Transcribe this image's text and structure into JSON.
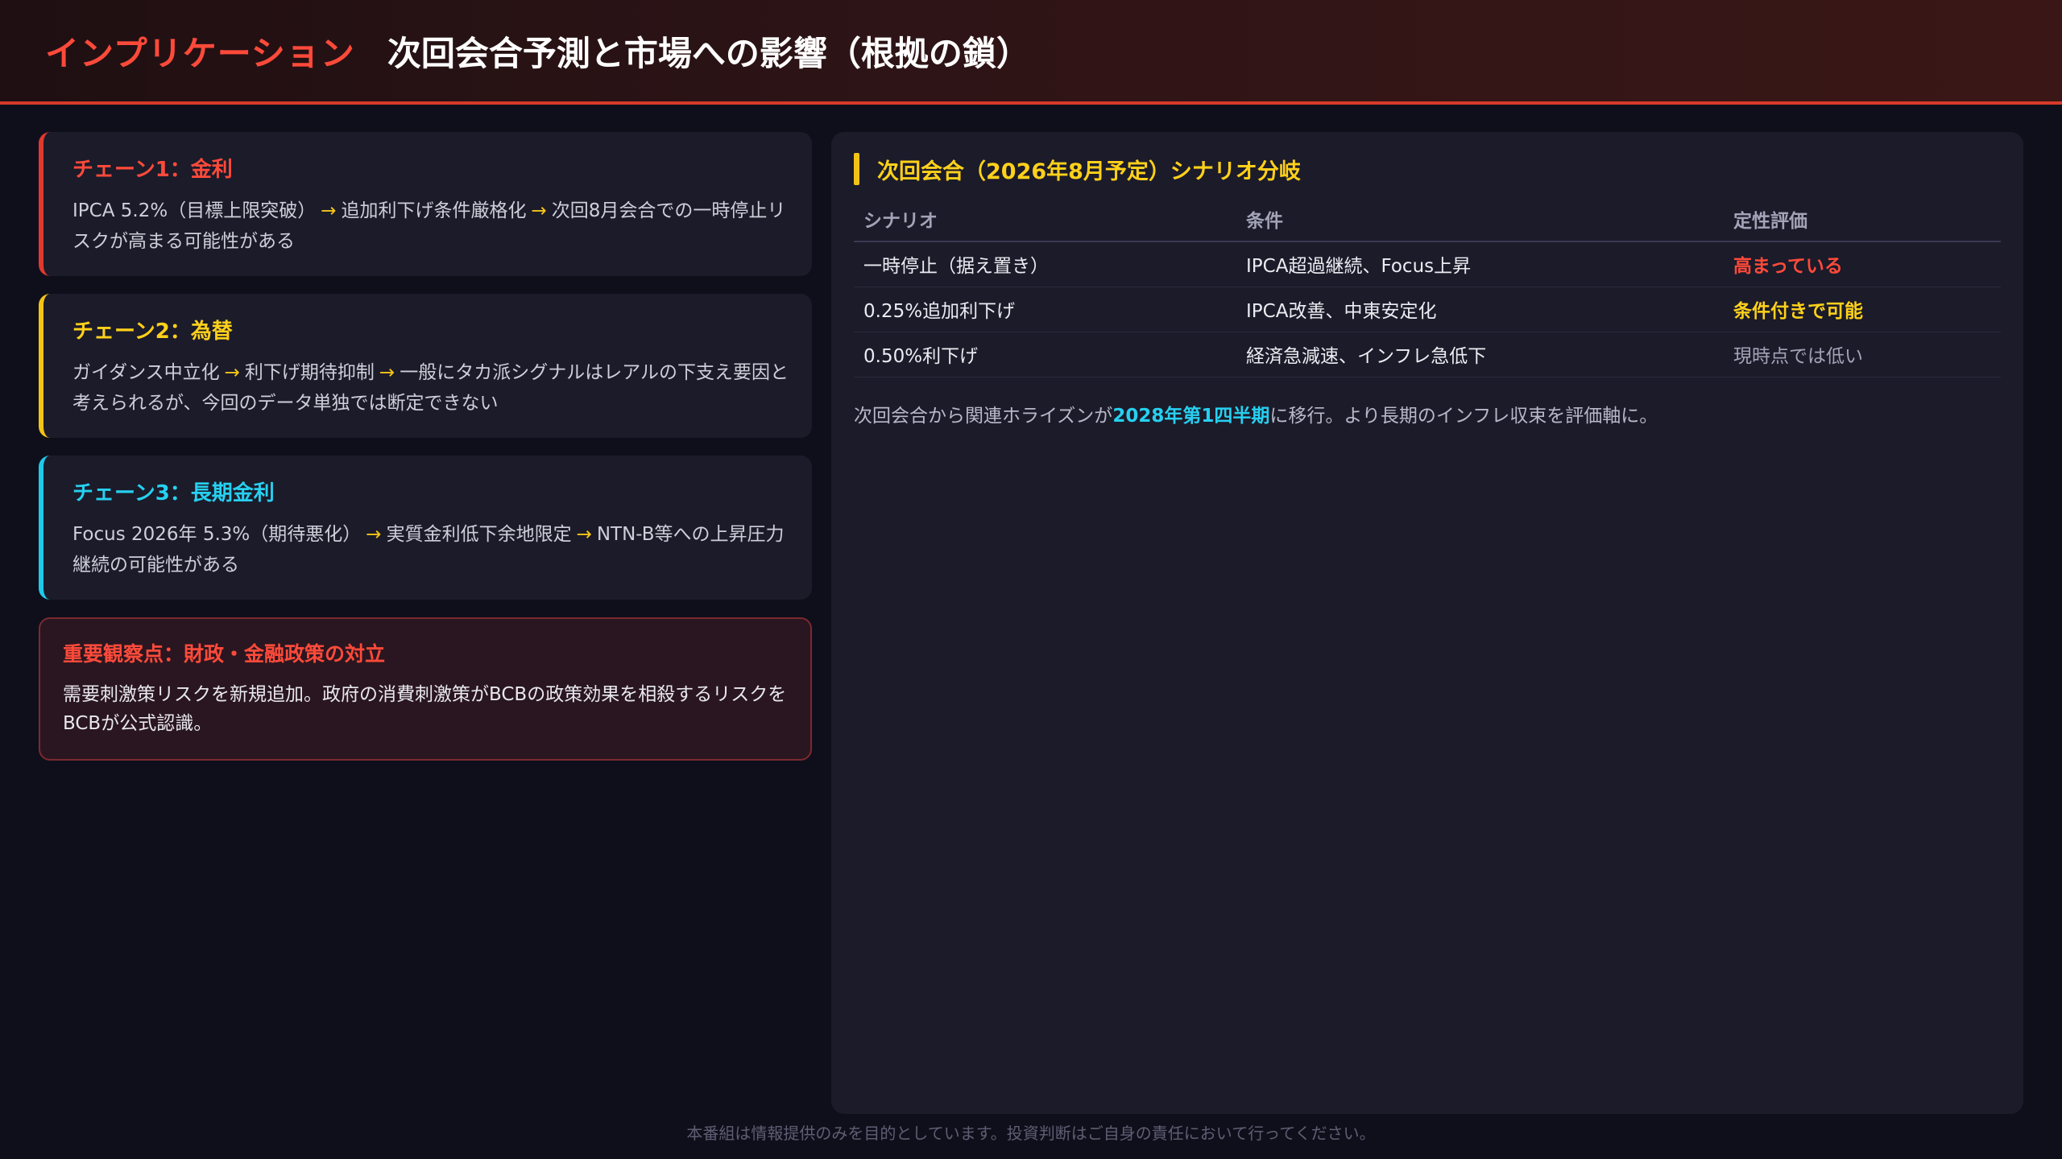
{
  "header": {
    "title_accent": "インプリケーション",
    "title_main": "次回会合予測と市場への影響（根拠の鎖）"
  },
  "chains": [
    {
      "title": "チェーン1：金利",
      "steps": [
        "IPCA 5.2%（目標上限突破）",
        "追加利下げ条件厳格化",
        "次回8月会合での一時停止リスクが高まる可能性がある"
      ]
    },
    {
      "title": "チェーン2：為替",
      "steps": [
        "ガイダンス中立化",
        "利下げ期待抑制",
        "一般にタカ派シグナルはレアルの下支え要因と考えられるが、今回のデータ単独では断定できない"
      ]
    },
    {
      "title": "チェーン3：長期金利",
      "steps": [
        "Focus 2026年 5.3%（期待悪化）",
        "実質金利低下余地限定",
        "NTN-B等への上昇圧力継続の可能性がある"
      ]
    }
  ],
  "arrow": "→",
  "alert": {
    "title": "重要観察点：財政・金融政策の対立",
    "body": "需要刺激策リスクを新規追加。政府の消費刺激策がBCBの政策効果を相殺するリスクをBCBが公式認識。"
  },
  "scenario": {
    "title": "次回会合（2026年8月予定）シナリオ分岐",
    "columns": [
      "シナリオ",
      "条件",
      "定性評価"
    ],
    "rows": [
      {
        "scenario": "一時停止（据え置き）",
        "condition": "IPCA超過継続、Focus上昇",
        "evaluation": "高まっている",
        "level": "high"
      },
      {
        "scenario": "0.25%追加利下げ",
        "condition": "IPCA改善、中東安定化",
        "evaluation": "条件付きで可能",
        "level": "mid"
      },
      {
        "scenario": "0.50%利下げ",
        "condition": "経済急減速、インフレ急低下",
        "evaluation": "現時点では低い",
        "level": "low"
      }
    ],
    "note_prefix": "次回会合から関連ホライズンが",
    "note_highlight": "2028年第1四半期",
    "note_suffix": "に移行。より長期のインフレ収束を評価軸に。"
  },
  "footer": "本番組は情報提供のみを目的としています。投資判断はご自身の責任において行ってください。",
  "colors": {
    "accent_red": "#ff4a3a",
    "accent_yellow": "#ffd11a",
    "accent_cyan": "#27d0f0",
    "background": "#0f0f1b",
    "panel": "#1b1b2a"
  }
}
